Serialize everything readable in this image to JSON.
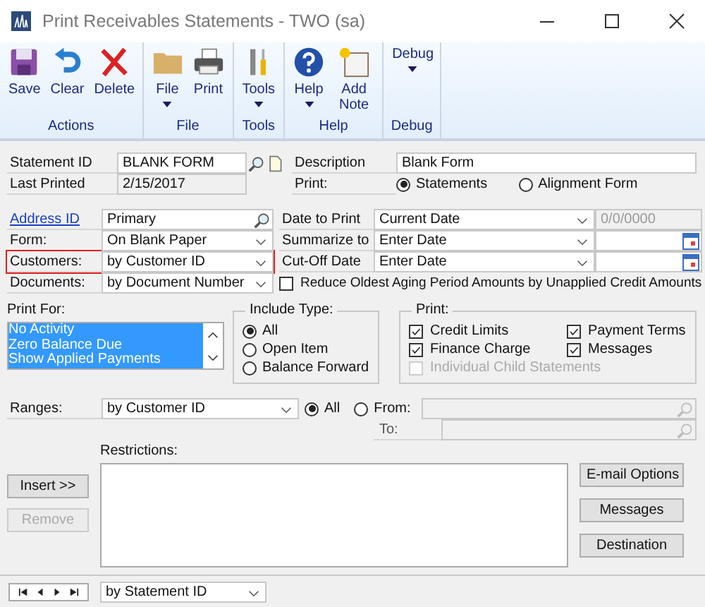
{
  "window": {
    "title": "Print Receivables Statements  -  TWO (sa)"
  },
  "ribbon": [
    {
      "label": "Actions",
      "buttons": [
        {
          "label": "Save",
          "kind": "save",
          "dropdown": false
        },
        {
          "label": "Clear",
          "kind": "clear",
          "dropdown": false
        },
        {
          "label": "Delete",
          "kind": "delete",
          "dropdown": false
        }
      ]
    },
    {
      "label": "File",
      "buttons": [
        {
          "label": "File",
          "kind": "folder",
          "dropdown": true
        },
        {
          "label": "Print",
          "kind": "printer",
          "dropdown": false
        }
      ]
    },
    {
      "label": "Tools",
      "buttons": [
        {
          "label": "Tools",
          "kind": "tools",
          "dropdown": true
        }
      ]
    },
    {
      "label": "Help",
      "buttons": [
        {
          "label": "Help",
          "kind": "help",
          "dropdown": true
        },
        {
          "label": "Add Note",
          "kind": "note",
          "dropdown": false
        }
      ]
    },
    {
      "label": "Debug",
      "buttons": [
        {
          "label": "Debug",
          "kind": "none",
          "dropdown": true
        }
      ]
    }
  ],
  "header": {
    "statement_id": {
      "label": "Statement ID",
      "value": "BLANK FORM"
    },
    "last_printed": {
      "label": "Last Printed",
      "value": "2/15/2017"
    },
    "description": {
      "label": "Description",
      "value": "Blank Form"
    },
    "print": {
      "label": "Print:",
      "options": [
        {
          "label": "Statements",
          "selected": true
        },
        {
          "label": "Alignment Form",
          "selected": false
        }
      ]
    }
  },
  "left_fields": [
    {
      "label": "Address ID",
      "value": "Primary",
      "kind": "lookup",
      "link": true,
      "highlighted": false
    },
    {
      "label": "Form:",
      "value": "On Blank Paper",
      "kind": "dropdown",
      "link": false,
      "highlighted": false
    },
    {
      "label": "Customers:",
      "value": "by Customer ID",
      "kind": "dropdown",
      "link": false,
      "highlighted": true
    },
    {
      "label": "Documents:",
      "value": "by Document Number",
      "kind": "dropdown",
      "link": false,
      "highlighted": false
    }
  ],
  "right_fields": [
    {
      "label": "Date to Print",
      "value": "Current Date",
      "kind": "fixed",
      "date": "0/0/0000"
    },
    {
      "label": "Summarize to",
      "value": "Enter Date",
      "kind": "calendar"
    },
    {
      "label": "Cut-Off Date",
      "value": "Enter Date",
      "kind": "calendar"
    }
  ],
  "reduce": {
    "label": "Reduce Oldest Aging Period Amounts by Unapplied Credit Amounts",
    "checked": false
  },
  "print_for": {
    "label": "Print For:",
    "items": [
      {
        "label": "No Activity",
        "selected": true
      },
      {
        "label": "Zero Balance Due",
        "selected": true
      },
      {
        "label": "Show Applied Payments",
        "selected": true
      }
    ]
  },
  "include_type": {
    "label": "Include Type:",
    "options": [
      {
        "label": "All",
        "selected": true
      },
      {
        "label": "Open Item",
        "selected": false
      },
      {
        "label": "Balance Forward",
        "selected": false
      }
    ]
  },
  "print_options": {
    "label": "Print:",
    "items": [
      {
        "label": "Credit Limits",
        "checked": true,
        "disabled": false
      },
      {
        "label": "Payment Terms",
        "checked": true,
        "disabled": false
      },
      {
        "label": "Finance Charge",
        "checked": true,
        "disabled": false
      },
      {
        "label": "Messages",
        "checked": true,
        "disabled": false
      },
      {
        "label": "Individual Child Statements",
        "checked": false,
        "disabled": true
      }
    ]
  },
  "ranges": {
    "label": "Ranges:",
    "value": "by Customer ID",
    "all": {
      "label": "All",
      "selected": true
    },
    "from": {
      "label": "From:",
      "selected": false
    },
    "to_label": "To:"
  },
  "restrictions": {
    "label": "Restrictions:"
  },
  "left_buttons": [
    {
      "label": "Insert >>",
      "disabled": false
    },
    {
      "label": "Remove",
      "disabled": true
    }
  ],
  "right_buttons": [
    "E-mail Options",
    "Messages",
    "Destination"
  ],
  "bottom": {
    "sort": "by Statement ID"
  }
}
